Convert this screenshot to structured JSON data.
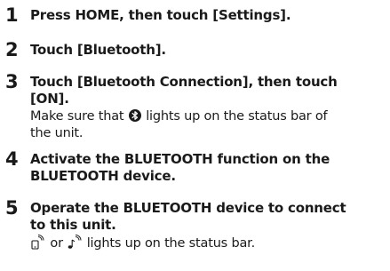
{
  "steps": [
    {
      "number": "1",
      "text": "Press HOME, then touch [Settings]."
    },
    {
      "number": "2",
      "text": "Touch [Bluetooth]."
    },
    {
      "number": "3",
      "text_line1": "Touch [Bluetooth Connection], then touch",
      "text_line2": "[ON].",
      "note_line1_before": "Make sure that",
      "note_line1_after": "lights up on the status bar of",
      "note_line2": "the unit."
    },
    {
      "number": "4",
      "text_line1": "Activate the BLUETOOTH function on the",
      "text_line2": "BLUETOOTH device."
    },
    {
      "number": "5",
      "text_line1": "Operate the BLUETOOTH device to connect",
      "text_line2": "to this unit.",
      "note_connector": "or",
      "note_after": "lights up on the status bar."
    }
  ],
  "icons": {
    "bluetooth": "bluetooth-icon",
    "phone_audio": "bluetooth-phone-audio-icon",
    "music_audio": "bluetooth-music-audio-icon"
  }
}
